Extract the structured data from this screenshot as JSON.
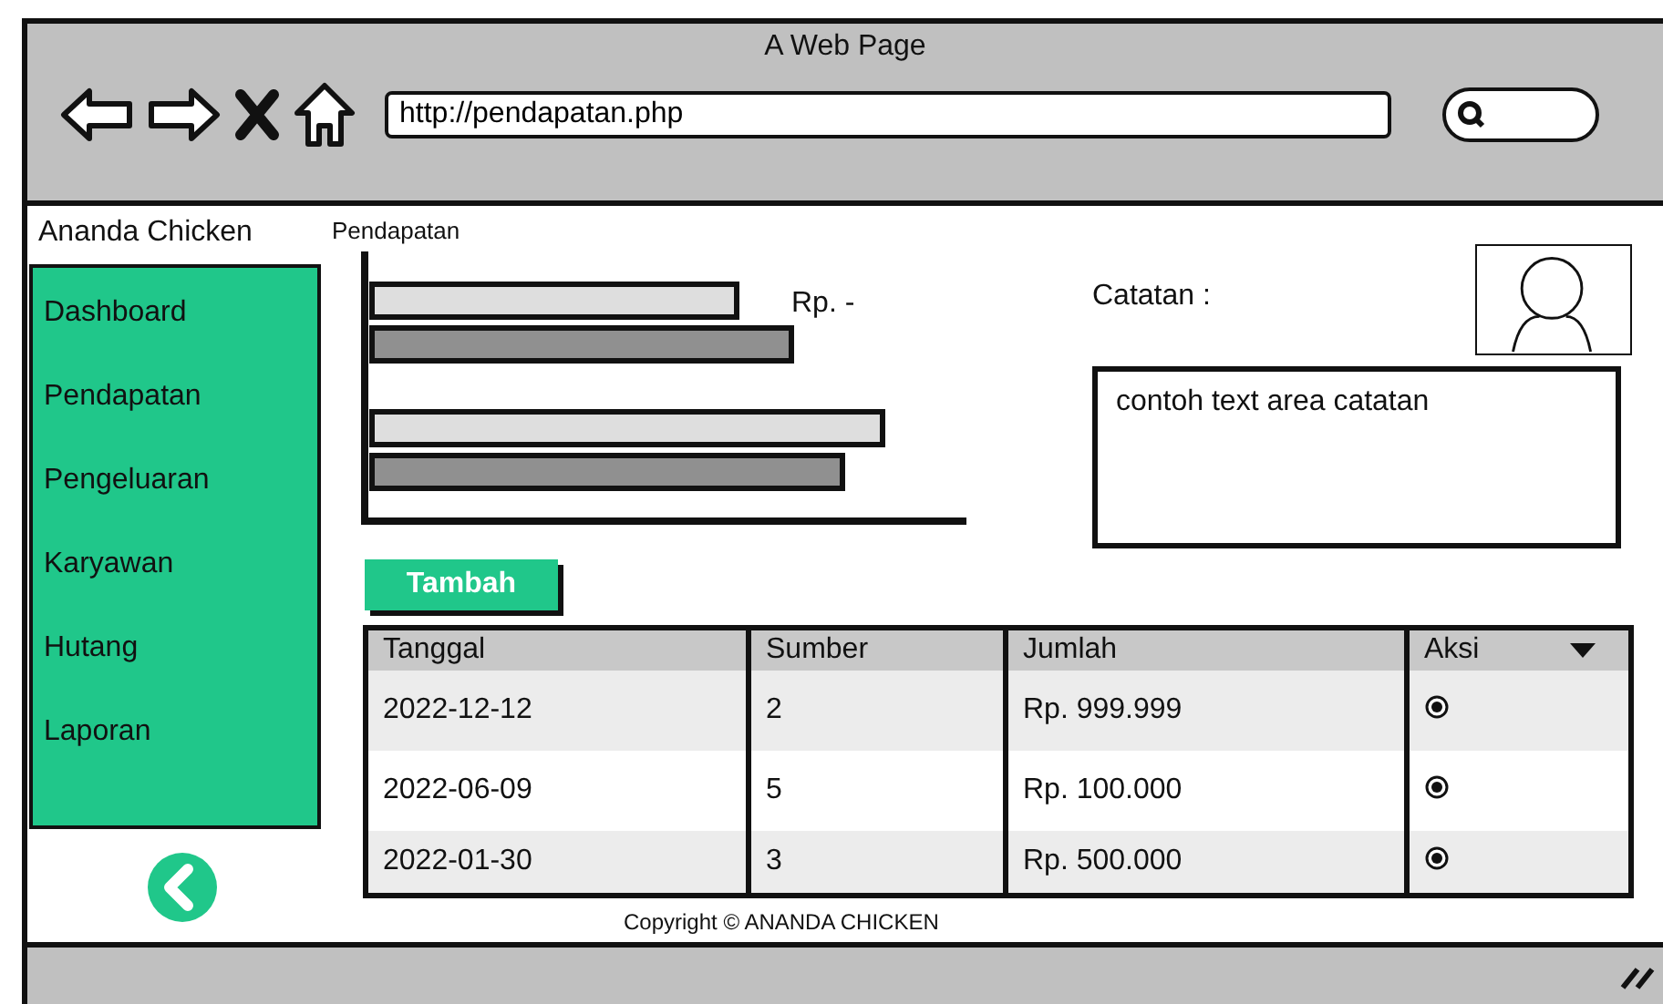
{
  "window": {
    "title": "A Web Page"
  },
  "browser": {
    "address": "http://pendapatan.php"
  },
  "app": {
    "brand": "Ananda Chicken",
    "page_title": "Pendapatan"
  },
  "sidebar": {
    "items": [
      {
        "label": "Dashboard"
      },
      {
        "label": "Pendapatan"
      },
      {
        "label": "Pengeluaran"
      },
      {
        "label": "Karyawan"
      },
      {
        "label": "Hutang"
      },
      {
        "label": "Laporan"
      }
    ]
  },
  "chart": {
    "label": "Rp. -"
  },
  "notes": {
    "label": "Catatan  :",
    "value": "contoh text area catatan"
  },
  "add_button": "Tambah",
  "table": {
    "columns": [
      "Tanggal",
      "Sumber",
      "Jumlah",
      "Aksi"
    ],
    "rows": [
      {
        "cells": [
          "2022-12-12",
          "2",
          "Rp. 999.999"
        ]
      },
      {
        "cells": [
          "2022-06-09",
          "5",
          "Rp. 100.000"
        ]
      },
      {
        "cells": [
          "2022-01-30",
          "3",
          "Rp. 500.000"
        ]
      }
    ]
  },
  "footer": "Copyright © ANANDA CHICKEN"
}
